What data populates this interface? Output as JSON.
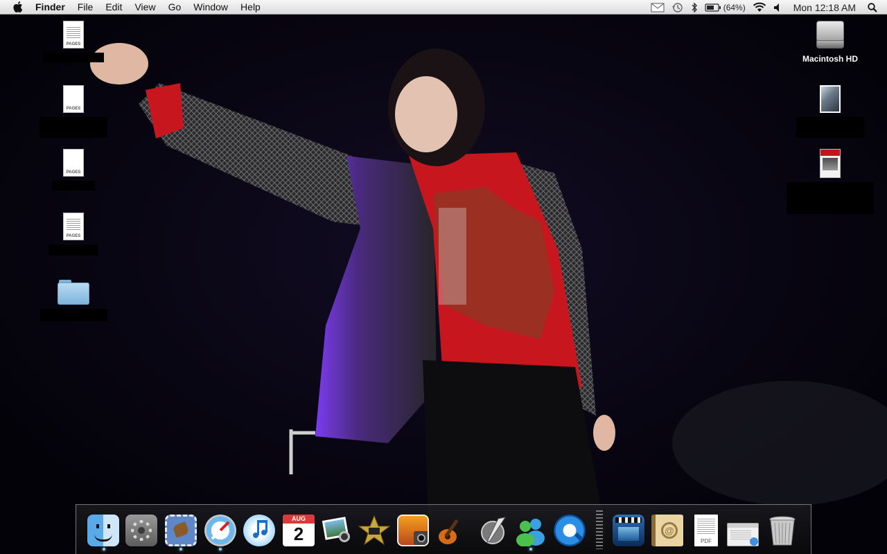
{
  "menubar": {
    "app_name": "Finder",
    "items": [
      "File",
      "Edit",
      "View",
      "Go",
      "Window",
      "Help"
    ],
    "battery_percent": "(64%)",
    "clock": "Mon 12:18 AM"
  },
  "desktop": {
    "left_icons": [
      {
        "kind": "pages-document",
        "label_redacted": true
      },
      {
        "kind": "pages-document",
        "label_redacted": true
      },
      {
        "kind": "pages-document",
        "label_redacted": true
      },
      {
        "kind": "pages-document",
        "label_redacted": true
      },
      {
        "kind": "folder",
        "label_redacted": true
      }
    ],
    "doc_type_tag": "PAGES",
    "right_icons": [
      {
        "kind": "hard-drive",
        "label": "Macintosh HD"
      },
      {
        "kind": "image-file",
        "label_redacted": true
      },
      {
        "kind": "pages-document",
        "label_redacted": true
      }
    ]
  },
  "dock": {
    "apps": [
      {
        "name": "Finder",
        "icon": "finder-icon",
        "running": true
      },
      {
        "name": "System Preferences",
        "icon": "system-preferences-icon",
        "running": false
      },
      {
        "name": "Mail",
        "icon": "mail-icon",
        "running": true
      },
      {
        "name": "Safari",
        "icon": "safari-icon",
        "running": true
      },
      {
        "name": "iTunes",
        "icon": "itunes-icon",
        "running": false
      },
      {
        "name": "iCal",
        "icon": "ical-icon",
        "running": false
      },
      {
        "name": "iPhoto",
        "icon": "iphoto-icon",
        "running": false
      },
      {
        "name": "iMovie",
        "icon": "imovie-icon",
        "running": false
      },
      {
        "name": "Photo Booth",
        "icon": "photo-booth-icon",
        "running": false
      },
      {
        "name": "GarageBand",
        "icon": "garageband-icon",
        "running": false
      },
      {
        "name": "Script Editor",
        "icon": "script-editor-icon",
        "running": false
      },
      {
        "name": "Messenger",
        "icon": "messenger-icon",
        "running": true
      },
      {
        "name": "QuickTime Player",
        "icon": "quicktime-icon",
        "running": false
      }
    ],
    "docs": [
      {
        "name": "Movies",
        "icon": "movies-stack-icon"
      },
      {
        "name": "Address Book",
        "icon": "address-book-icon"
      },
      {
        "name": "PDF Document",
        "icon": "pdf-document-icon",
        "tag": "PDF"
      },
      {
        "name": "Downloads",
        "icon": "downloads-window-icon"
      },
      {
        "name": "Trash",
        "icon": "trash-icon"
      }
    ],
    "ical_month": "AUG",
    "ical_day": "2"
  },
  "colors": {
    "menubar_top": "#f6f6f6",
    "menubar_bottom": "#dcdcdc",
    "desktop_bg": "#04030a",
    "jacket_purple": "#6b2bd8",
    "shirt_red": "#c8161e",
    "dock_indicator": "#7fd4ff"
  }
}
